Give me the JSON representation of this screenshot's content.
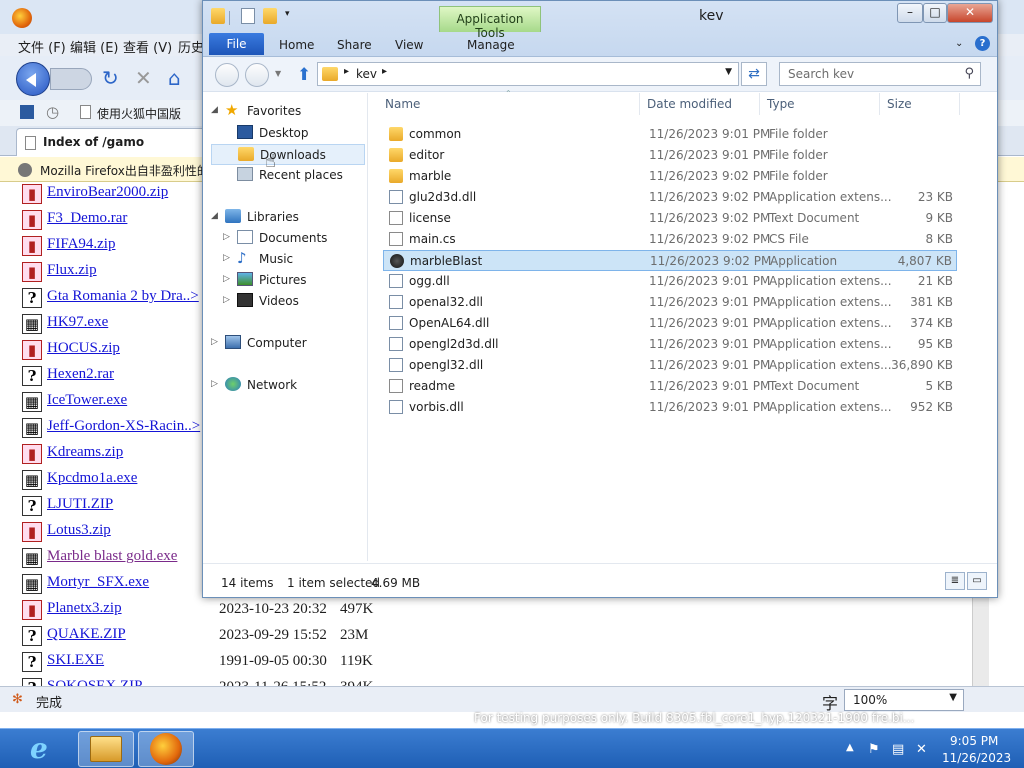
{
  "firefox": {
    "menu": [
      "文件 (F)",
      "编辑 (E)",
      "查看 (V)",
      "历史"
    ],
    "bookmark_item": "使用火狐中国版",
    "tab_title": "Index of /gamo",
    "notification": "Mozilla Firefox出自非盈利性的",
    "status_text": "完成",
    "ime_indicator": "字",
    "zoom_level": "100%",
    "files": [
      {
        "name": "EnviroBear2000.zip",
        "icon": "zip",
        "date": "",
        "size": ""
      },
      {
        "name": "F3_Demo.rar",
        "icon": "zip",
        "date": "",
        "size": ""
      },
      {
        "name": "FIFA94.zip",
        "icon": "zip",
        "date": "",
        "size": ""
      },
      {
        "name": "Flux.zip",
        "icon": "zip",
        "date": "",
        "size": ""
      },
      {
        "name": "Gta Romania 2 by Dra..>",
        "icon": "unknown",
        "date": "",
        "size": ""
      },
      {
        "name": "HK97.exe",
        "icon": "exe",
        "date": "",
        "size": ""
      },
      {
        "name": "HOCUS.zip",
        "icon": "zip",
        "date": "",
        "size": ""
      },
      {
        "name": "Hexen2.rar",
        "icon": "unknown",
        "date": "",
        "size": ""
      },
      {
        "name": "IceTower.exe",
        "icon": "exe",
        "date": "",
        "size": ""
      },
      {
        "name": "Jeff-Gordon-XS-Racin..>",
        "icon": "exe",
        "date": "",
        "size": ""
      },
      {
        "name": "Kdreams.zip",
        "icon": "zip",
        "date": "",
        "size": ""
      },
      {
        "name": "Kpcdmo1a.exe",
        "icon": "exe",
        "date": "",
        "size": ""
      },
      {
        "name": "LJUTI.ZIP",
        "icon": "unknown",
        "date": "",
        "size": ""
      },
      {
        "name": "Lotus3.zip",
        "icon": "zip",
        "date": "",
        "size": ""
      },
      {
        "name": "Marble blast gold.exe",
        "icon": "exe",
        "date": "",
        "size": "",
        "visited": true
      },
      {
        "name": "Mortyr_SFX.exe",
        "icon": "exe",
        "date": "",
        "size": ""
      },
      {
        "name": "Planetx3.zip",
        "icon": "zip",
        "date": "2023-10-23 20:32",
        "size": "497K"
      },
      {
        "name": "QUAKE.ZIP",
        "icon": "unknown",
        "date": "2023-09-29 15:52",
        "size": "23M"
      },
      {
        "name": "SKI.EXE",
        "icon": "unknown",
        "date": "1991-09-05 00:30",
        "size": "119K"
      },
      {
        "name": "SOKOSEX.ZIP",
        "icon": "unknown",
        "date": "2023-11-26 15:52",
        "size": "394K"
      }
    ]
  },
  "explorer": {
    "app_tools_label": "Application Tools",
    "title": "kev",
    "ribbon_tabs": {
      "file": "File",
      "home": "Home",
      "share": "Share",
      "view": "View",
      "manage": "Manage"
    },
    "path": "kev",
    "search_placeholder": "Search kev",
    "nav": {
      "favorites": "Favorites",
      "desktop": "Desktop",
      "downloads": "Downloads",
      "recent": "Recent places",
      "libraries": "Libraries",
      "documents": "Documents",
      "music": "Music",
      "pictures": "Pictures",
      "videos": "Videos",
      "computer": "Computer",
      "network": "Network"
    },
    "columns": {
      "name": "Name",
      "date": "Date modified",
      "type": "Type",
      "size": "Size"
    },
    "files": [
      {
        "name": "common",
        "date": "11/26/2023 9:01 PM",
        "type": "File folder",
        "size": "",
        "icon": "folder"
      },
      {
        "name": "editor",
        "date": "11/26/2023 9:01 PM",
        "type": "File folder",
        "size": "",
        "icon": "folder"
      },
      {
        "name": "marble",
        "date": "11/26/2023 9:02 PM",
        "type": "File folder",
        "size": "",
        "icon": "folder"
      },
      {
        "name": "glu2d3d.dll",
        "date": "11/26/2023 9:02 PM",
        "type": "Application extens...",
        "size": "23 KB",
        "icon": "dll"
      },
      {
        "name": "license",
        "date": "11/26/2023 9:02 PM",
        "type": "Text Document",
        "size": "9 KB",
        "icon": "doc"
      },
      {
        "name": "main.cs",
        "date": "11/26/2023 9:02 PM",
        "type": "CS File",
        "size": "8 KB",
        "icon": "doc"
      },
      {
        "name": "marbleBlast",
        "date": "11/26/2023 9:02 PM",
        "type": "Application",
        "size": "4,807 KB",
        "icon": "app",
        "selected": true
      },
      {
        "name": "ogg.dll",
        "date": "11/26/2023 9:01 PM",
        "type": "Application extens...",
        "size": "21 KB",
        "icon": "dll"
      },
      {
        "name": "openal32.dll",
        "date": "11/26/2023 9:01 PM",
        "type": "Application extens...",
        "size": "381 KB",
        "icon": "dll"
      },
      {
        "name": "OpenAL64.dll",
        "date": "11/26/2023 9:01 PM",
        "type": "Application extens...",
        "size": "374 KB",
        "icon": "dll"
      },
      {
        "name": "opengl2d3d.dll",
        "date": "11/26/2023 9:01 PM",
        "type": "Application extens...",
        "size": "95 KB",
        "icon": "dll"
      },
      {
        "name": "opengl32.dll",
        "date": "11/26/2023 9:01 PM",
        "type": "Application extens...",
        "size": "36,890 KB",
        "icon": "dll"
      },
      {
        "name": "readme",
        "date": "11/26/2023 9:01 PM",
        "type": "Text Document",
        "size": "5 KB",
        "icon": "doc"
      },
      {
        "name": "vorbis.dll",
        "date": "11/26/2023 9:01 PM",
        "type": "Application extens...",
        "size": "952 KB",
        "icon": "dll"
      }
    ],
    "status": {
      "items": "14 items",
      "selected": "1 item selected",
      "size": "4.69 MB"
    }
  },
  "desktop_watermark": "For testing purposes only. Build 8305.fbl_core1_hyp.120321-1900 fre.bi...",
  "taskbar": {
    "time": "9:05 PM",
    "date": "11/26/2023"
  },
  "colors": {
    "taskbar": "#1f5fb5",
    "selection": "#cce4f7",
    "link": "#1515d6"
  }
}
